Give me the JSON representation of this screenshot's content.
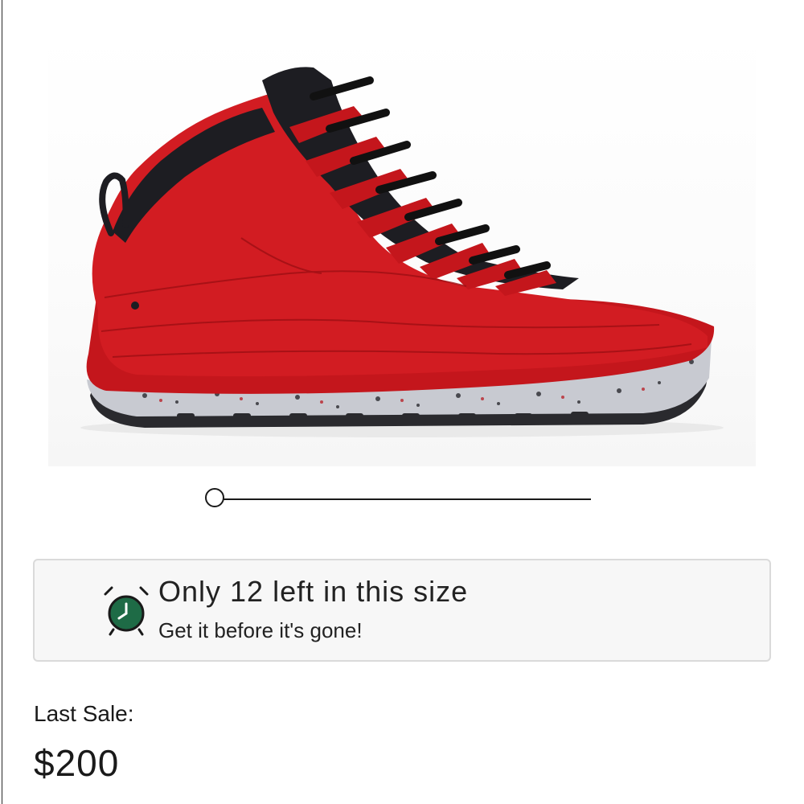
{
  "product": {
    "image_subject": "red and black high-top sneaker with speckled grey midsole"
  },
  "carousel": {
    "current_index": 1,
    "total": 2
  },
  "stock_alert": {
    "icon": "alarm-clock-icon",
    "headline": "Only 12 left in this size",
    "subline": "Get it before it's gone!",
    "accent_color": "#1e6b46"
  },
  "last_sale": {
    "label": "Last Sale:",
    "price": "$200"
  }
}
